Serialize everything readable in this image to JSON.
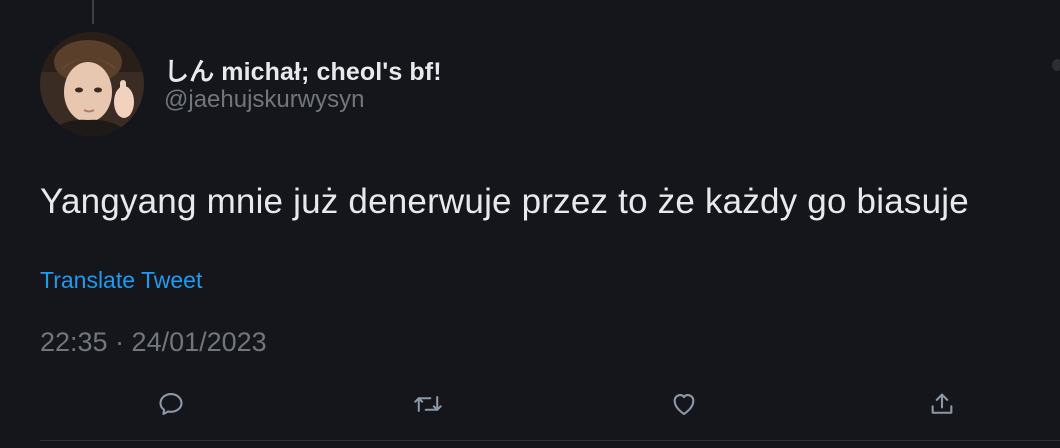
{
  "tweet": {
    "author": {
      "display_name": "しん michał; cheol's bf!",
      "handle": "@jaehujskurwysyn",
      "avatar": "profile-photo"
    },
    "text": "Yangyang mnie już denerwuje przez to że każdy go biasuje",
    "translate_label": "Translate Tweet",
    "timestamp": "22:35 · 24/01/2023"
  },
  "actions": [
    {
      "name": "reply",
      "icon": "reply-icon"
    },
    {
      "name": "retweet",
      "icon": "retweet-icon"
    },
    {
      "name": "like",
      "icon": "heart-icon"
    },
    {
      "name": "share",
      "icon": "share-icon"
    }
  ],
  "colors": {
    "background": "#15151c",
    "primary_text": "#e7e9ea",
    "secondary_text": "#71767b",
    "link": "#1d9bf0"
  }
}
